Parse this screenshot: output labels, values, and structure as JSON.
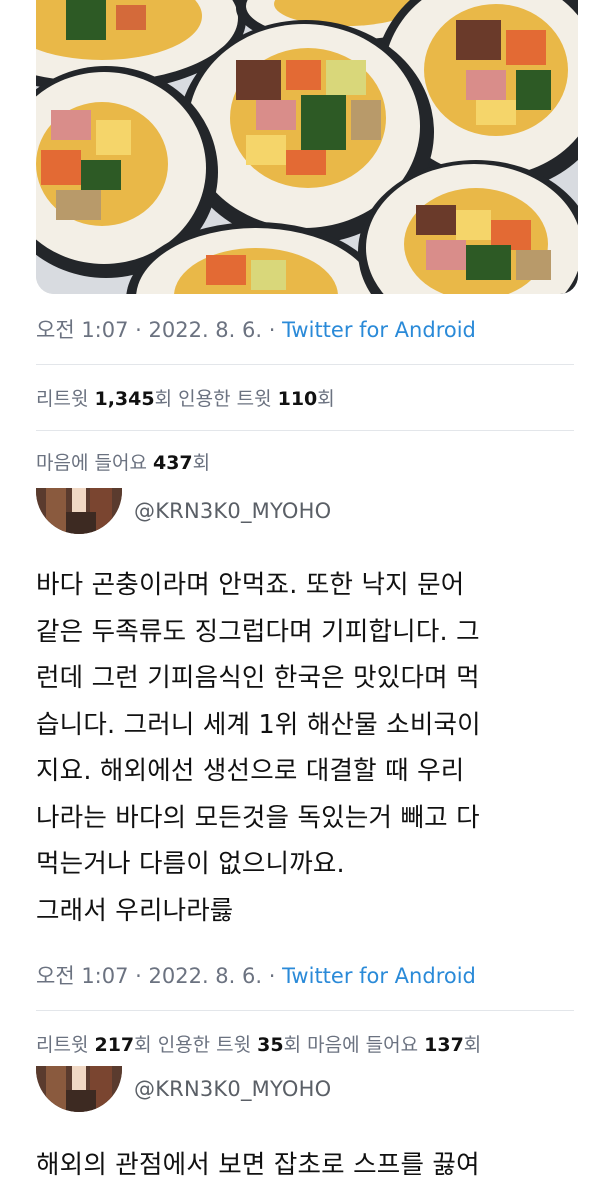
{
  "tweet1": {
    "meta": {
      "time": "오전 1:07 · 2022. 8. 6. · ",
      "source": "Twitter for Android"
    },
    "stats": {
      "retweet_label": "리트윗 ",
      "retweet_count": "1,345",
      "retweet_unit": "회  ",
      "quote_label": "인용한 트윗 ",
      "quote_count": "110",
      "quote_unit": "회"
    },
    "likes": {
      "label": "마음에 들어요 ",
      "count": "437",
      "unit": "회"
    }
  },
  "reply1": {
    "handle": "@KRN3K0_MYOHO",
    "lines": [
      "바다 곤충이라며 안먹죠. 또한 낙지 문어",
      "같은 두족류도 징그럽다며 기피합니다. 그",
      "런데 그런 기피음식인 한국은 맛있다며 먹",
      "습니다. 그러니 세계 1위 해산물 소비국이",
      "지요. 해외에선 생선으로 대결할 때 우리",
      "나라는 바다의 모든것을 독있는거 빼고 다",
      "먹는거나 다름이 없으니까요.",
      "그래서 우리나라릃"
    ],
    "meta": {
      "time": "오전 1:07 · 2022. 8. 6. · ",
      "source": "Twitter for Android"
    },
    "stats": {
      "retweet_label": "리트윗 ",
      "retweet_count": "217",
      "retweet_unit": "회  ",
      "quote_label": "인용한 트윗 ",
      "quote_count": "35",
      "quote_unit": "회  ",
      "likes_label": "마음에 들어요 ",
      "likes_count": "137",
      "likes_unit": "회"
    }
  },
  "reply2": {
    "handle": "@KRN3K0_MYOHO",
    "lines": [
      "해외의 관점에서 보면 잡초로 스프를 끓여"
    ]
  },
  "colors": {
    "link": "#2a8ad8",
    "secondary_text": "#6b7280",
    "divider": "#e3e6ea"
  },
  "icons": {
    "photo": "gimbap-photo",
    "avatar": "user-avatar"
  }
}
